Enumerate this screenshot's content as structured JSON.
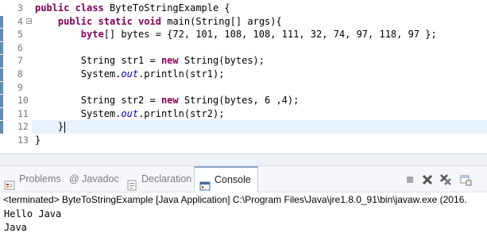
{
  "editor": {
    "line_numbers": [
      "3",
      "4",
      "5",
      "6",
      "7",
      "8",
      "9",
      "10",
      "11",
      "12",
      "13"
    ],
    "lines": [
      {
        "segments": [
          {
            "t": "public",
            "c": "kw"
          },
          {
            "t": " "
          },
          {
            "t": "class",
            "c": "kw"
          },
          {
            "t": " ByteToStringExample {"
          }
        ]
      },
      {
        "segments": [
          {
            "t": "    "
          },
          {
            "t": "public",
            "c": "kw"
          },
          {
            "t": " "
          },
          {
            "t": "static",
            "c": "kw"
          },
          {
            "t": " "
          },
          {
            "t": "void",
            "c": "kw"
          },
          {
            "t": " main(String[] args){"
          }
        ]
      },
      {
        "segments": [
          {
            "t": "        "
          },
          {
            "t": "byte",
            "c": "kw"
          },
          {
            "t": "[] bytes = {72, 101, 108, 108, 111, 32, 74, 97, 118, 97 };"
          }
        ]
      },
      {
        "segments": [
          {
            "t": ""
          }
        ]
      },
      {
        "segments": [
          {
            "t": "        String str1 = "
          },
          {
            "t": "new",
            "c": "kw"
          },
          {
            "t": " String(bytes);"
          }
        ]
      },
      {
        "segments": [
          {
            "t": "        System."
          },
          {
            "t": "out",
            "c": "fld"
          },
          {
            "t": ".println(str1);"
          }
        ]
      },
      {
        "segments": [
          {
            "t": ""
          }
        ]
      },
      {
        "segments": [
          {
            "t": "        String str2 = "
          },
          {
            "t": "new",
            "c": "kw"
          },
          {
            "t": " String(bytes, 6 ,4);"
          }
        ]
      },
      {
        "segments": [
          {
            "t": "        System."
          },
          {
            "t": "out",
            "c": "fld"
          },
          {
            "t": ".println(str2);"
          }
        ]
      },
      {
        "segments": [
          {
            "t": "    }"
          }
        ],
        "current": true
      },
      {
        "segments": [
          {
            "t": "}"
          }
        ]
      }
    ],
    "folded_lines": [
      "4"
    ]
  },
  "console_view": {
    "tabs": [
      {
        "label": "Problems",
        "icon": "problems-icon"
      },
      {
        "label": "@ Javadoc",
        "icon": "javadoc-icon"
      },
      {
        "label": "Declaration",
        "icon": "declaration-icon"
      },
      {
        "label": "Console",
        "icon": "console-icon",
        "active": true
      }
    ],
    "toolbar": [
      "terminate-icon",
      "remove-launch-icon",
      "remove-all-terminated-icon",
      "pin-console-icon"
    ],
    "header": "<terminated> ByteToStringExample [Java Application] C:\\Program Files\\Java\\jre1.8.0_91\\bin\\javaw.exe (2016.",
    "output": [
      "Hello Java",
      "Java"
    ]
  },
  "colors": {
    "keyword": "#7f0055",
    "field": "#0000c0",
    "current_line": "#e8f2fe",
    "change_marker": "#5e8fb5"
  }
}
